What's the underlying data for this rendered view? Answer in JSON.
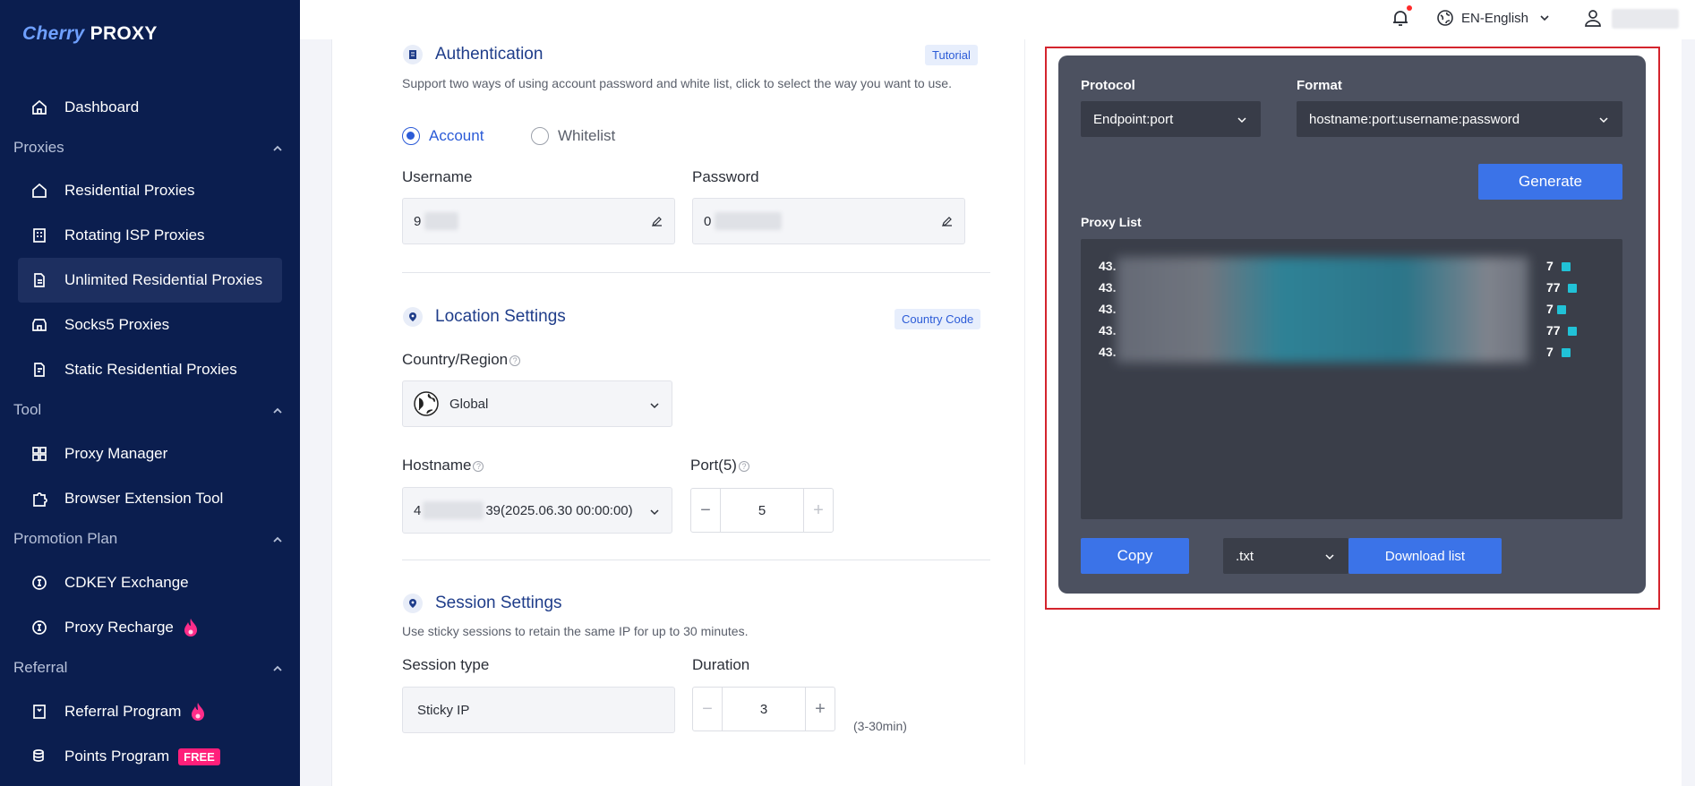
{
  "brand": {
    "logo_cherry": "Cherry",
    "logo_proxy": "PROXY"
  },
  "sidebar": {
    "dashboard": "Dashboard",
    "sections": {
      "proxies": "Proxies",
      "tool": "Tool",
      "promotion": "Promotion Plan",
      "referral": "Referral"
    },
    "items": {
      "residential": "Residential Proxies",
      "rotating_isp": "Rotating ISP Proxies",
      "unlimited_residential": "Unlimited Residential Proxies",
      "socks5": "Socks5 Proxies",
      "static_residential": "Static Residential Proxies",
      "proxy_manager": "Proxy Manager",
      "browser_extension": "Browser Extension Tool",
      "cdkey": "CDKEY Exchange",
      "proxy_recharge": "Proxy Recharge",
      "referral_program": "Referral Program",
      "points_program": "Points Program",
      "free_badge": "FREE"
    }
  },
  "topbar": {
    "language": "EN-English"
  },
  "auth": {
    "title": "Authentication",
    "tutorial": "Tutorial",
    "description": "Support two ways of using account password and white list, click to select the way you want to use.",
    "radio_account": "Account",
    "radio_whitelist": "Whitelist",
    "username_label": "Username",
    "username_value": "9",
    "password_label": "Password",
    "password_value": "0"
  },
  "location": {
    "title": "Location Settings",
    "country_code": "Country Code",
    "country_label": "Country/Region",
    "country_value": "Global",
    "hostname_label": "Hostname",
    "hostname_prefix": "4",
    "hostname_suffix": "39(2025.06.30 00:00:00)",
    "port_label": "Port(5)",
    "port_value": "5"
  },
  "session": {
    "title": "Session Settings",
    "description": "Use sticky sessions to retain the same IP for up to 30 minutes.",
    "type_label": "Session type",
    "type_value": "Sticky IP",
    "duration_label": "Duration",
    "duration_value": "3",
    "duration_note": "(3-30min)"
  },
  "generator": {
    "protocol_label": "Protocol",
    "protocol_value": "Endpoint:port",
    "format_label": "Format",
    "format_value": "hostname:port:username:password",
    "generate_label": "Generate",
    "proxy_list_label": "Proxy List",
    "proxies": [
      {
        "prefix": "43.",
        "suffix": "7"
      },
      {
        "prefix": "43.",
        "suffix": "77"
      },
      {
        "prefix": "43.",
        "suffix": "7"
      },
      {
        "prefix": "43.",
        "suffix": "77"
      },
      {
        "prefix": "43.",
        "suffix": "7"
      }
    ],
    "copy_label": "Copy",
    "file_type": ".txt",
    "download_label": "Download list"
  },
  "colors": {
    "sidebar_bg": "#0b1e4f",
    "accent": "#3b73e8",
    "panel_bg": "#4c5160",
    "highlight_frame": "#d4242d"
  }
}
